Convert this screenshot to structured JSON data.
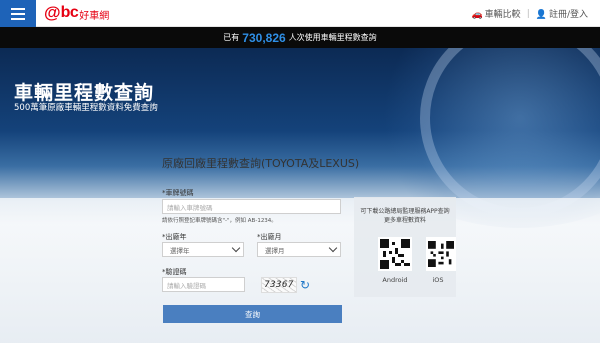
{
  "topnav": {
    "logo_symbol": "@",
    "logo_text": "bc",
    "logo_zh": "好車網",
    "compare_label": "車輛比較",
    "login_label": "註冊/登入",
    "separator": "|"
  },
  "banner": {
    "prefix": "已有",
    "count": "730,826",
    "suffix": "人次使用車輛里程數查詢"
  },
  "hero": {
    "title": "車輛里程數查詢",
    "subtitle": "500萬筆原廠車輛里程數資料免費查詢"
  },
  "form": {
    "title": "原廠回廠里程數查詢(TOYOTA及LEXUS)",
    "plate_label": "*車牌號碼",
    "plate_placeholder": "請輸入車牌號碼",
    "plate_hint": "請依行照登記車牌號碼含\"-\"，例如 AB-1234。",
    "year_label": "*出廠年",
    "year_value": "選擇年",
    "month_label": "*出廠月",
    "month_value": "選擇月",
    "captcha_label": "*驗證碼",
    "captcha_placeholder": "請輸入驗證碼",
    "captcha_code": "73367",
    "submit_label": "查詢"
  },
  "app": {
    "text": "可下載公路總局監理服務APP查詢更多車程數資料",
    "android_label": "Android",
    "ios_label": "iOS"
  },
  "colors": {
    "brand_red": "#e60012",
    "nav_blue": "#1e63b8",
    "count_blue": "#2f8fe6",
    "button_blue": "#4a7fc0"
  }
}
